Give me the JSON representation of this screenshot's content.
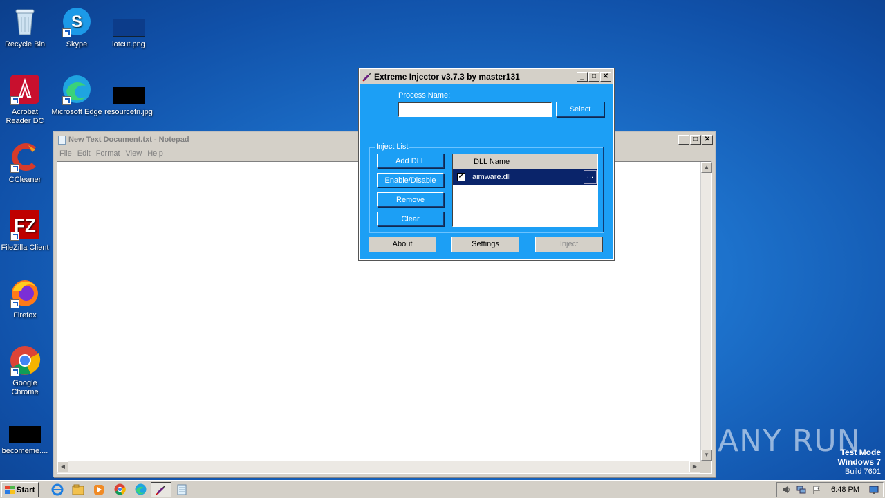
{
  "desktop": {
    "icons": [
      {
        "label": "Recycle Bin"
      },
      {
        "label": "Skype"
      },
      {
        "label": "lotcut.png"
      },
      {
        "label": "Acrobat Reader DC"
      },
      {
        "label": "Microsoft Edge"
      },
      {
        "label": "resourcefri.jpg"
      },
      {
        "label": "CCleaner"
      },
      {
        "label": "FileZilla Client"
      },
      {
        "label": "Firefox"
      },
      {
        "label": "Google Chrome"
      },
      {
        "label": "becomeme...."
      }
    ]
  },
  "notepad": {
    "title": "New Text Document.txt - Notepad",
    "menu": [
      "File",
      "Edit",
      "Format",
      "View",
      "Help"
    ],
    "content": ""
  },
  "injector": {
    "title": "Extreme Injector v3.7.3 by master131",
    "process_label": "Process Name:",
    "process_value": "",
    "select_label": "Select",
    "inject_list_label": "Inject List",
    "add_dll": "Add DLL",
    "enable_disable": "Enable/Disable",
    "remove": "Remove",
    "clear": "Clear",
    "dll_header": "DLL Name",
    "dlls": [
      {
        "name": "aimware.dll",
        "checked": true
      }
    ],
    "ellipsis": "...",
    "about": "About",
    "settings": "Settings",
    "inject": "Inject"
  },
  "taskbar": {
    "start": "Start",
    "clock": "6:48 PM"
  },
  "watermark": {
    "line1": "Test Mode",
    "line2": "Windows 7",
    "line3": "Build 7601",
    "brand": "ANY RUN"
  },
  "colors": {
    "injector_bg": "#1c9ff5",
    "desktop": "#1d72cc",
    "selection": "#0a246a"
  }
}
